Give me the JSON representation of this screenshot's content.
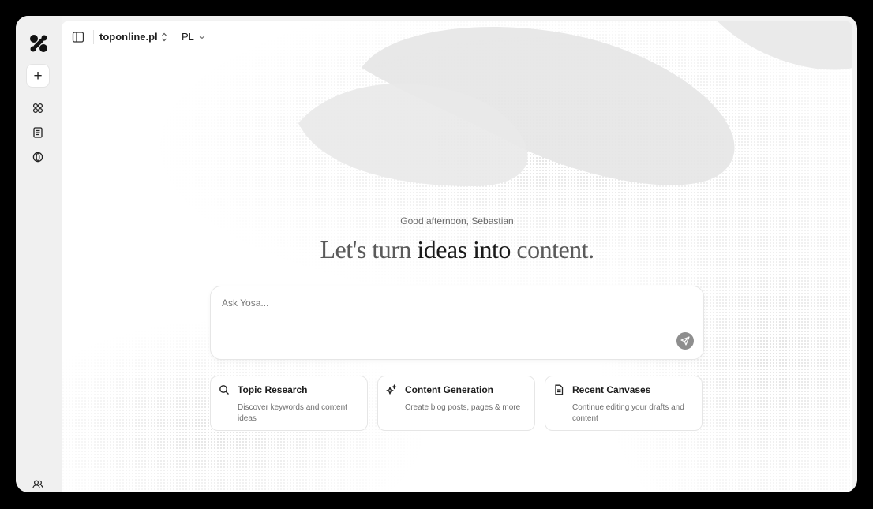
{
  "topbar": {
    "site_name": "toponline.pl",
    "language": "PL"
  },
  "sidebar": {
    "new_label": "+",
    "items": [
      {
        "icon": "grid-icon"
      },
      {
        "icon": "document-icon"
      },
      {
        "icon": "globe-icon"
      }
    ],
    "bottom_icon": "users-icon"
  },
  "main": {
    "greeting": "Good afternoon, Sebastian",
    "headline_part1": "Let's turn ",
    "headline_strong1": "ideas",
    "headline_part2": " ",
    "headline_strong2": "into",
    "headline_part3": " content.",
    "prompt": {
      "placeholder": "Ask Yosa...",
      "value": ""
    },
    "cards": [
      {
        "title": "Topic Research",
        "description": "Discover keywords and content ideas",
        "icon": "search-icon"
      },
      {
        "title": "Content Generation",
        "description": "Create blog posts, pages & more",
        "icon": "sparkles-icon"
      },
      {
        "title": "Recent Canvases",
        "description": "Continue editing your drafts and content",
        "icon": "document-icon"
      }
    ]
  },
  "colors": {
    "frame": "#000000",
    "sidebar_bg": "#f0f0f0",
    "main_bg": "#ffffff",
    "send_button": "#8e8e8e"
  }
}
